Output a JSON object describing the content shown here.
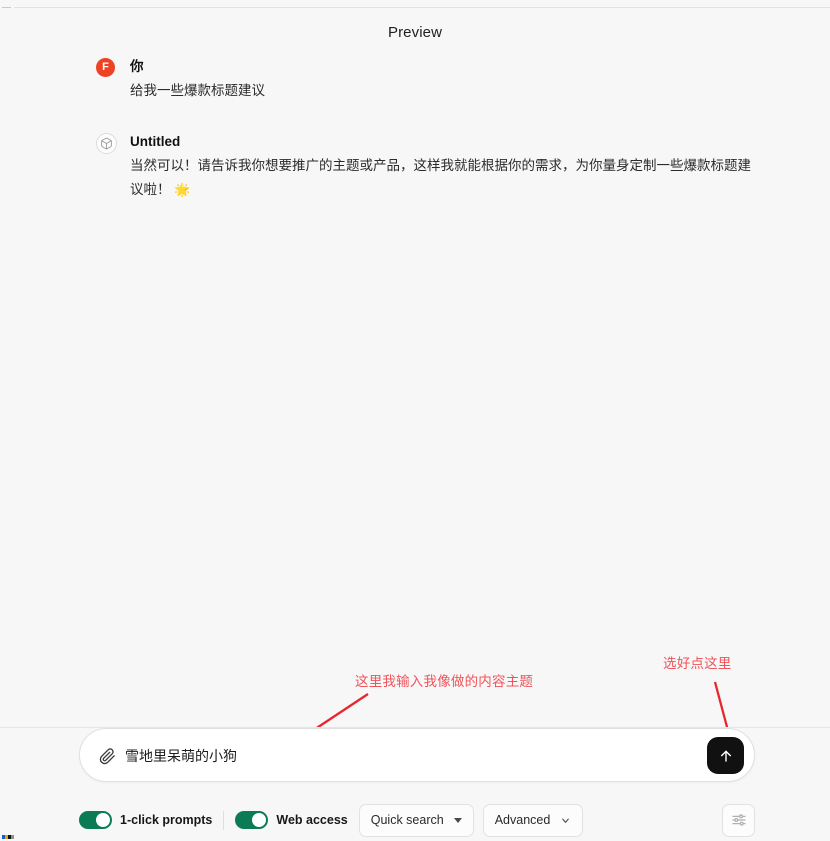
{
  "header": {
    "title": "Preview"
  },
  "conversation": {
    "messages": [
      {
        "author": "你",
        "avatar_letter": "F",
        "avatar_color": "#ef4123",
        "avatar_icon": "user-avatar",
        "body": "给我一些爆款标题建议"
      },
      {
        "author": "Untitled",
        "avatar_icon": "cube-icon",
        "body": "当然可以！请告诉我你想要推广的主题或产品，这样我就能根据你的需求，为你量身定制一些爆款标题建议啦！",
        "emoji": "🌟"
      }
    ]
  },
  "annotations": {
    "input_hint": "这里我输入我像做的内容主题",
    "send_hint": "选好点这里",
    "color": "#f0545a"
  },
  "composer": {
    "attach_icon": "paperclip-icon",
    "input_value": "雪地里呆萌的小狗",
    "input_placeholder": "",
    "send_icon": "arrow-up-icon",
    "send_color": "#111111"
  },
  "toolbar": {
    "toggles": [
      {
        "label": "1-click prompts",
        "on": true,
        "color": "#0b7b56"
      },
      {
        "label": "Web access",
        "on": true,
        "color": "#0b7b56"
      }
    ],
    "dropdowns": [
      {
        "label": "Quick search",
        "caret": "caret-down-solid-icon"
      },
      {
        "label": "Advanced",
        "caret": "chevron-down-icon"
      }
    ],
    "settings_icon": "sliders-icon"
  }
}
